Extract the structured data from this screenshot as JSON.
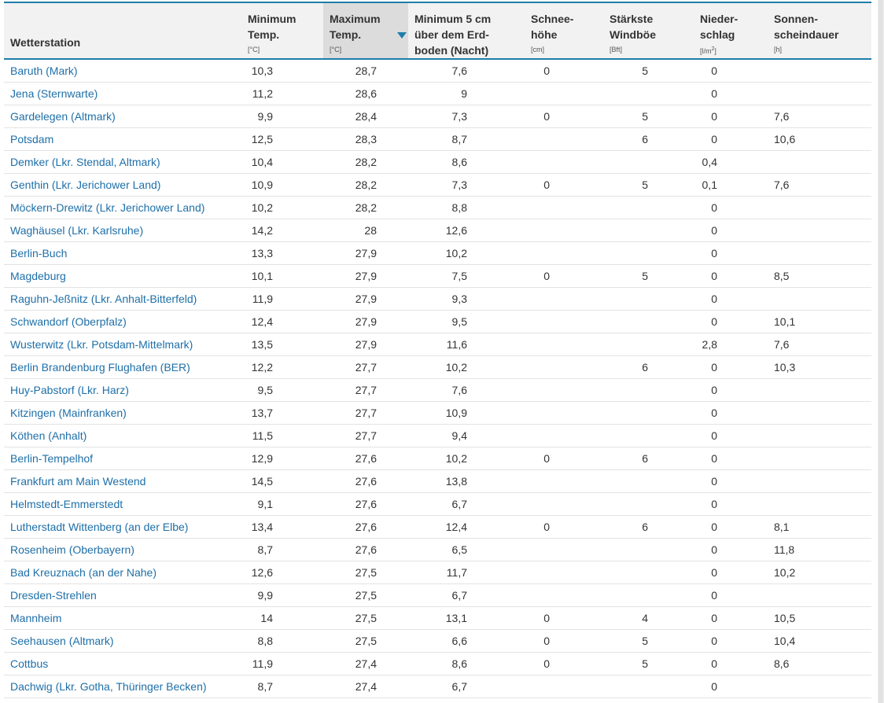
{
  "table": {
    "headers": {
      "station": "Wetterstation",
      "min_temp": [
        "Minimum",
        "Temp."
      ],
      "min_temp_unit": "[°C]",
      "max_temp": [
        "Maximum",
        "Temp."
      ],
      "max_temp_unit": "[°C]",
      "ground": [
        "Minimum 5 cm",
        "über dem Erd-",
        "boden (Nacht)"
      ],
      "snow": [
        "Schnee-",
        "höhe"
      ],
      "snow_unit": "[cm]",
      "wind": [
        "Stärkste",
        "Windböe"
      ],
      "wind_unit": "[Bft]",
      "rain": [
        "Nieder-",
        "schlag"
      ],
      "rain_unit_base": "[l/m",
      "rain_unit_sup": "2",
      "rain_unit_end": "]",
      "sun": [
        "Sonnen-",
        "scheindauer"
      ],
      "sun_unit": "[h]"
    },
    "sorted_column": "max_temp",
    "rows": [
      {
        "station": "Baruth (Mark)",
        "min": "10,3",
        "max": "28,7",
        "ground": "7,6",
        "snow": "0",
        "wind": "5",
        "rain": "0",
        "sun": ""
      },
      {
        "station": "Jena (Sternwarte)",
        "min": "11,2",
        "max": "28,6",
        "ground": "9",
        "snow": "",
        "wind": "",
        "rain": "0",
        "sun": ""
      },
      {
        "station": "Gardelegen (Altmark)",
        "min": "9,9",
        "max": "28,4",
        "ground": "7,3",
        "snow": "0",
        "wind": "5",
        "rain": "0",
        "sun": "7,6"
      },
      {
        "station": "Potsdam",
        "min": "12,5",
        "max": "28,3",
        "ground": "8,7",
        "snow": "",
        "wind": "6",
        "rain": "0",
        "sun": "10,6"
      },
      {
        "station": "Demker (Lkr. Stendal, Altmark)",
        "min": "10,4",
        "max": "28,2",
        "ground": "8,6",
        "snow": "",
        "wind": "",
        "rain": "0,4",
        "sun": ""
      },
      {
        "station": "Genthin (Lkr. Jerichower Land)",
        "min": "10,9",
        "max": "28,2",
        "ground": "7,3",
        "snow": "0",
        "wind": "5",
        "rain": "0,1",
        "sun": "7,6"
      },
      {
        "station": "Möckern-Drewitz (Lkr. Jerichower Land)",
        "min": "10,2",
        "max": "28,2",
        "ground": "8,8",
        "snow": "",
        "wind": "",
        "rain": "0",
        "sun": ""
      },
      {
        "station": "Waghäusel (Lkr. Karlsruhe)",
        "min": "14,2",
        "max": "28",
        "ground": "12,6",
        "snow": "",
        "wind": "",
        "rain": "0",
        "sun": ""
      },
      {
        "station": "Berlin-Buch",
        "min": "13,3",
        "max": "27,9",
        "ground": "10,2",
        "snow": "",
        "wind": "",
        "rain": "0",
        "sun": ""
      },
      {
        "station": "Magdeburg",
        "min": "10,1",
        "max": "27,9",
        "ground": "7,5",
        "snow": "0",
        "wind": "5",
        "rain": "0",
        "sun": "8,5"
      },
      {
        "station": "Raguhn-Jeßnitz (Lkr. Anhalt-Bitterfeld)",
        "min": "11,9",
        "max": "27,9",
        "ground": "9,3",
        "snow": "",
        "wind": "",
        "rain": "0",
        "sun": ""
      },
      {
        "station": "Schwandorf (Oberpfalz)",
        "min": "12,4",
        "max": "27,9",
        "ground": "9,5",
        "snow": "",
        "wind": "",
        "rain": "0",
        "sun": "10,1"
      },
      {
        "station": "Wusterwitz (Lkr. Potsdam-Mittelmark)",
        "min": "13,5",
        "max": "27,9",
        "ground": "11,6",
        "snow": "",
        "wind": "",
        "rain": "2,8",
        "sun": "7,6"
      },
      {
        "station": "Berlin Brandenburg Flughafen (BER)",
        "min": "12,2",
        "max": "27,7",
        "ground": "10,2",
        "snow": "",
        "wind": "6",
        "rain": "0",
        "sun": "10,3"
      },
      {
        "station": "Huy-Pabstorf (Lkr. Harz)",
        "min": "9,5",
        "max": "27,7",
        "ground": "7,6",
        "snow": "",
        "wind": "",
        "rain": "0",
        "sun": ""
      },
      {
        "station": "Kitzingen (Mainfranken)",
        "min": "13,7",
        "max": "27,7",
        "ground": "10,9",
        "snow": "",
        "wind": "",
        "rain": "0",
        "sun": ""
      },
      {
        "station": "Köthen (Anhalt)",
        "min": "11,5",
        "max": "27,7",
        "ground": "9,4",
        "snow": "",
        "wind": "",
        "rain": "0",
        "sun": ""
      },
      {
        "station": "Berlin-Tempelhof",
        "min": "12,9",
        "max": "27,6",
        "ground": "10,2",
        "snow": "0",
        "wind": "6",
        "rain": "0",
        "sun": ""
      },
      {
        "station": "Frankfurt am Main Westend",
        "min": "14,5",
        "max": "27,6",
        "ground": "13,8",
        "snow": "",
        "wind": "",
        "rain": "0",
        "sun": ""
      },
      {
        "station": "Helmstedt-Emmerstedt",
        "min": "9,1",
        "max": "27,6",
        "ground": "6,7",
        "snow": "",
        "wind": "",
        "rain": "0",
        "sun": ""
      },
      {
        "station": "Lutherstadt Wittenberg (an der Elbe)",
        "min": "13,4",
        "max": "27,6",
        "ground": "12,4",
        "snow": "0",
        "wind": "6",
        "rain": "0",
        "sun": "8,1"
      },
      {
        "station": "Rosenheim (Oberbayern)",
        "min": "8,7",
        "max": "27,6",
        "ground": "6,5",
        "snow": "",
        "wind": "",
        "rain": "0",
        "sun": "11,8"
      },
      {
        "station": "Bad Kreuznach (an der Nahe)",
        "min": "12,6",
        "max": "27,5",
        "ground": "11,7",
        "snow": "",
        "wind": "",
        "rain": "0",
        "sun": "10,2"
      },
      {
        "station": "Dresden-Strehlen",
        "min": "9,9",
        "max": "27,5",
        "ground": "6,7",
        "snow": "",
        "wind": "",
        "rain": "0",
        "sun": ""
      },
      {
        "station": "Mannheim",
        "min": "14",
        "max": "27,5",
        "ground": "13,1",
        "snow": "0",
        "wind": "4",
        "rain": "0",
        "sun": "10,5"
      },
      {
        "station": "Seehausen (Altmark)",
        "min": "8,8",
        "max": "27,5",
        "ground": "6,6",
        "snow": "0",
        "wind": "5",
        "rain": "0",
        "sun": "10,4"
      },
      {
        "station": "Cottbus",
        "min": "11,9",
        "max": "27,4",
        "ground": "8,6",
        "snow": "0",
        "wind": "5",
        "rain": "0",
        "sun": "8,6"
      },
      {
        "station": "Dachwig (Lkr. Gotha, Thüringer Becken)",
        "min": "8,7",
        "max": "27,4",
        "ground": "6,7",
        "snow": "",
        "wind": "",
        "rain": "0",
        "sun": ""
      }
    ]
  }
}
